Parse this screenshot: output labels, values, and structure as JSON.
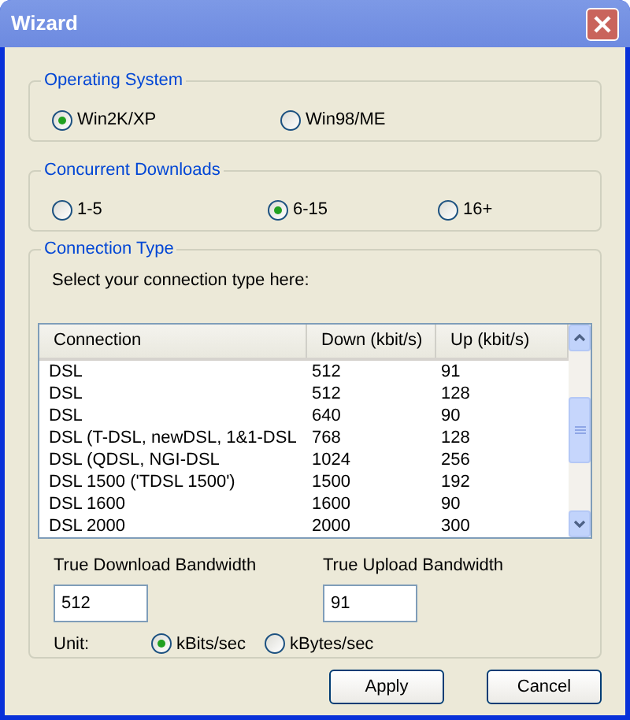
{
  "window": {
    "title": "Wizard"
  },
  "operating_system": {
    "legend": "Operating System",
    "options": [
      {
        "label": "Win2K/XP",
        "selected": true
      },
      {
        "label": "Win98/ME",
        "selected": false
      }
    ]
  },
  "concurrent_downloads": {
    "legend": "Concurrent Downloads",
    "options": [
      {
        "label": "1-5",
        "selected": false
      },
      {
        "label": "6-15",
        "selected": true
      },
      {
        "label": "16+",
        "selected": false
      }
    ]
  },
  "connection_type": {
    "legend": "Connection Type",
    "instruction": "Select your connection type here:",
    "table": {
      "columns": [
        "Connection",
        "Down (kbit/s)",
        "Up (kbit/s)"
      ],
      "rows": [
        [
          "DSL",
          "512",
          "91"
        ],
        [
          "DSL",
          "512",
          "128"
        ],
        [
          "DSL",
          "640",
          "90"
        ],
        [
          "DSL (T-DSL, newDSL, 1&1-DSL",
          "768",
          "128"
        ],
        [
          "DSL (QDSL, NGI-DSL",
          "1024",
          "256"
        ],
        [
          "DSL 1500 ('TDSL 1500')",
          "1500",
          "192"
        ],
        [
          "DSL 1600",
          "1600",
          "90"
        ],
        [
          "DSL 2000",
          "2000",
          "300"
        ]
      ]
    },
    "download": {
      "label": "True Download Bandwidth",
      "value": "512"
    },
    "upload": {
      "label": "True Upload Bandwidth",
      "value": "91"
    },
    "unit": {
      "label": "Unit:",
      "options": [
        {
          "label": "kBits/sec",
          "selected": true
        },
        {
          "label": "kBytes/sec",
          "selected": false
        }
      ]
    }
  },
  "buttons": [
    "Apply",
    "Cancel"
  ]
}
